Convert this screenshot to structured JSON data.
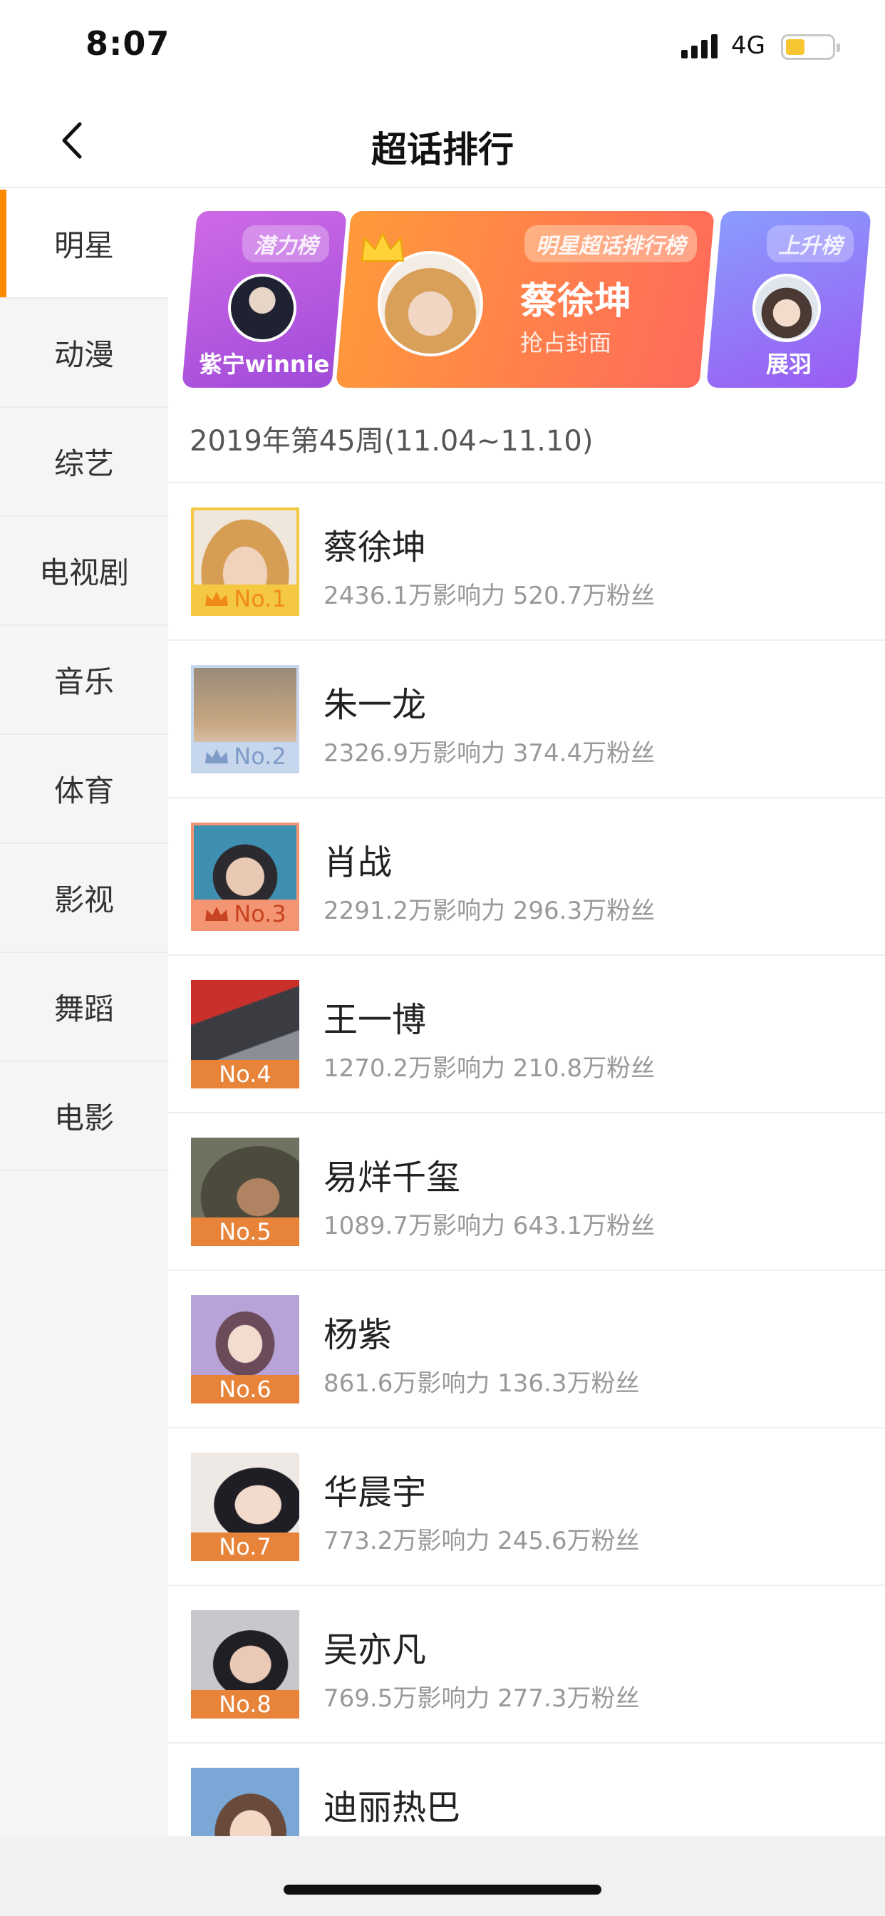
{
  "status_bar": {
    "time": "8:07",
    "network": "4G"
  },
  "nav": {
    "title": "超话排行"
  },
  "sidebar": {
    "items": [
      {
        "label": "明星",
        "active": true
      },
      {
        "label": "动漫"
      },
      {
        "label": "综艺"
      },
      {
        "label": "电视剧"
      },
      {
        "label": "音乐"
      },
      {
        "label": "体育"
      },
      {
        "label": "影视"
      },
      {
        "label": "舞蹈"
      },
      {
        "label": "电影"
      }
    ]
  },
  "banner": {
    "left": {
      "tag": "潜力榜",
      "name": "紫宁winnie"
    },
    "main": {
      "tag": "明星超话排行榜",
      "name": "蔡徐坤",
      "subtitle": "抢占封面"
    },
    "right": {
      "tag": "上升榜",
      "name": "展羽"
    }
  },
  "week_label": "2019年第45周(11.04~11.10)",
  "ranking": [
    {
      "rank": "No.1",
      "name": "蔡徐坤",
      "stats": "2436.1万影响力 520.7万粉丝",
      "badge_color": "#f5c842",
      "crown": true
    },
    {
      "rank": "No.2",
      "name": "朱一龙",
      "stats": "2326.9万影响力 374.4万粉丝",
      "badge_color": "#b8cbe6",
      "crown": true
    },
    {
      "rank": "No.3",
      "name": "肖战",
      "stats": "2291.2万影响力 296.3万粉丝",
      "badge_color": "#f39472",
      "crown": true
    },
    {
      "rank": "No.4",
      "name": "王一博",
      "stats": "1270.2万影响力 210.8万粉丝",
      "badge_color": "#e8843a",
      "crown": false
    },
    {
      "rank": "No.5",
      "name": "易烊千玺",
      "stats": "1089.7万影响力 643.1万粉丝",
      "badge_color": "#e8843a",
      "crown": false
    },
    {
      "rank": "No.6",
      "name": "杨紫",
      "stats": "861.6万影响力 136.3万粉丝",
      "badge_color": "#e8843a",
      "crown": false
    },
    {
      "rank": "No.7",
      "name": "华晨宇",
      "stats": "773.2万影响力 245.6万粉丝",
      "badge_color": "#e8843a",
      "crown": false
    },
    {
      "rank": "No.8",
      "name": "吴亦凡",
      "stats": "769.5万影响力 277.3万粉丝",
      "badge_color": "#e8843a",
      "crown": false
    },
    {
      "rank": "",
      "name": "迪丽热巴",
      "stats": "",
      "badge_color": "#e8843a",
      "crown": false
    }
  ],
  "colors": {
    "accent": "#ff8a00"
  }
}
